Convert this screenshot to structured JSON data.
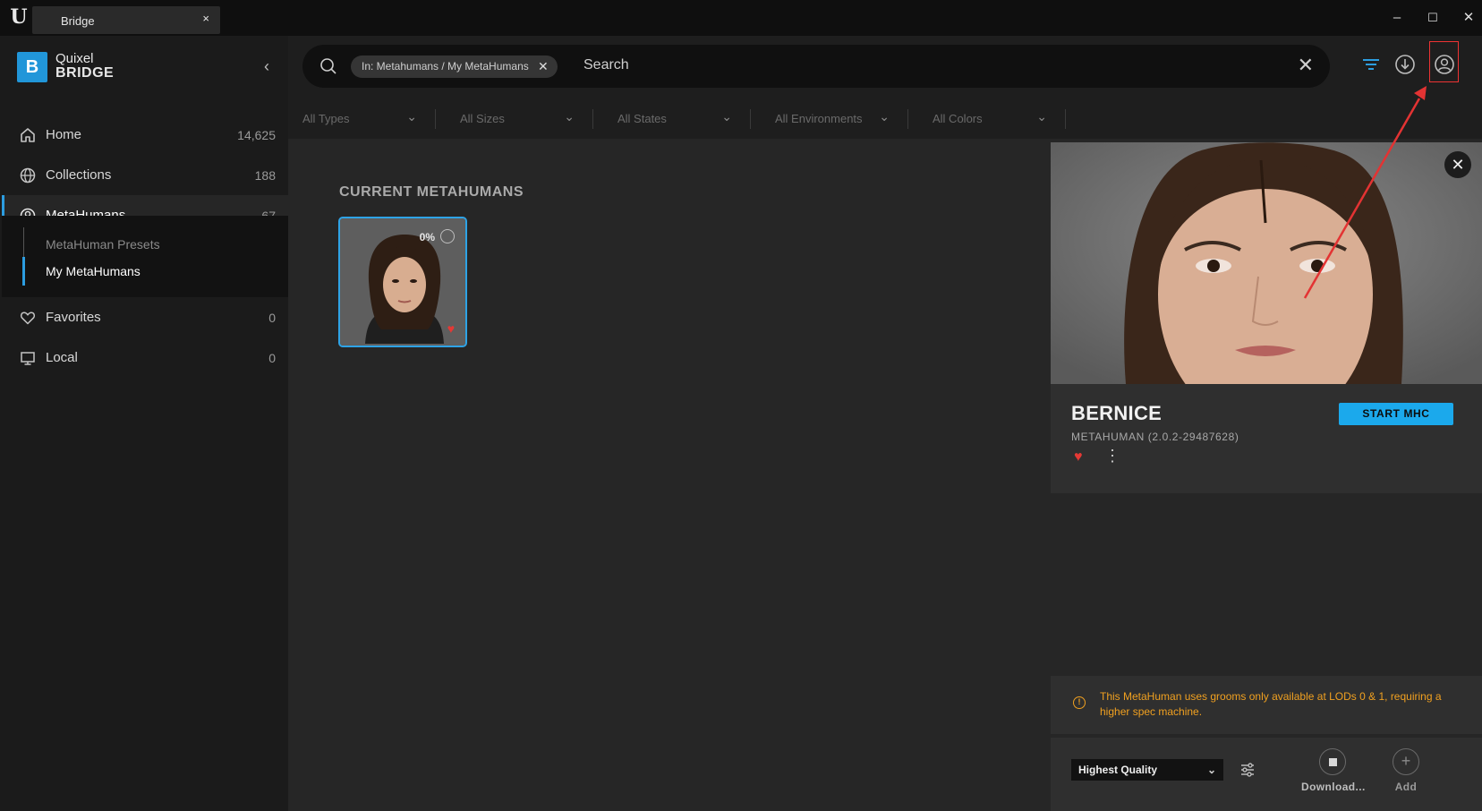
{
  "titlebar": {
    "tab_title": "Bridge",
    "tab_close": "×",
    "minimize": "–",
    "maximize": "☐",
    "close": "✕"
  },
  "brand": {
    "line1": "Quixel",
    "line2": "BRIDGE",
    "collapse": "‹"
  },
  "sidebar": {
    "items": [
      {
        "label": "Home",
        "count": "14,625",
        "icon": "home-icon"
      },
      {
        "label": "Collections",
        "count": "188",
        "icon": "globe-icon"
      },
      {
        "label": "MetaHumans",
        "count": "67",
        "icon": "user-circle-icon"
      },
      {
        "label": "Favorites",
        "count": "0",
        "icon": "heart-icon"
      },
      {
        "label": "Local",
        "count": "0",
        "icon": "monitor-icon"
      }
    ],
    "sub_items": [
      {
        "label": "MetaHuman Presets"
      },
      {
        "label": "My MetaHumans"
      }
    ]
  },
  "search": {
    "chip": "In: Metahumans / My MetaHumans",
    "chip_close": "✕",
    "placeholder": "Search",
    "clear": "✕"
  },
  "filters": [
    "All Types",
    "All Sizes",
    "All States",
    "All Environments",
    "All Colors"
  ],
  "main": {
    "section_title": "CURRENT METAHUMANS",
    "card": {
      "progress": "0%"
    }
  },
  "detail": {
    "name": "BERNICE",
    "version": "METAHUMAN (2.0.2-29487628)",
    "start_button": "START MHC",
    "warning": "This MetaHuman uses grooms only available at LODs 0 & 1, requiring a higher spec machine.",
    "quality": "Highest Quality",
    "download_label": "Download...",
    "add_label": "Add"
  },
  "colors": {
    "accent": "#2c9de0",
    "warning": "#f0a020",
    "heart": "#e53935",
    "annotation": "#e33333"
  }
}
